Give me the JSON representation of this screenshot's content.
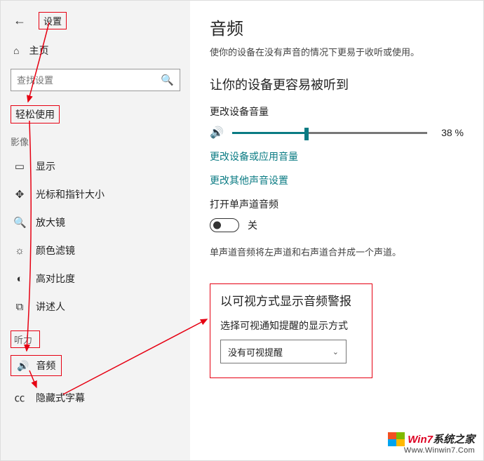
{
  "window": {
    "title": "设置"
  },
  "sidebar": {
    "home": "主页",
    "search_placeholder": "查找设置",
    "ease_header": "轻松使用",
    "category_vision": "影像",
    "items_vision": [
      {
        "label": "显示"
      },
      {
        "label": "光标和指针大小"
      },
      {
        "label": "放大镜"
      },
      {
        "label": "颜色滤镜"
      },
      {
        "label": "高对比度"
      },
      {
        "label": "讲述人"
      }
    ],
    "category_hearing": "听力",
    "audio_item": "音频",
    "cc_item": "隐藏式字幕"
  },
  "main": {
    "title": "音频",
    "subtitle": "使你的设备在没有声音的情况下更易于收听或使用。",
    "listen_heading": "让你的设备更容易被听到",
    "volume_label": "更改设备音量",
    "volume_pct": "38 %",
    "link_app_volume": "更改设备或应用音量",
    "link_other_sound": "更改其他声音设置",
    "mono_label": "打开单声道音频",
    "mono_state": "关",
    "mono_note": "单声道音频将左声道和右声道合并成一个声道。",
    "visual_alert_heading": "以可视方式显示音频警报",
    "visual_alert_field": "选择可视通知提醒的显示方式",
    "visual_alert_value": "没有可视提醒"
  },
  "watermark": {
    "line1_prefix": "Win7",
    "line1_suffix": "系统之家",
    "line2": "Www.Winwin7.Com"
  }
}
